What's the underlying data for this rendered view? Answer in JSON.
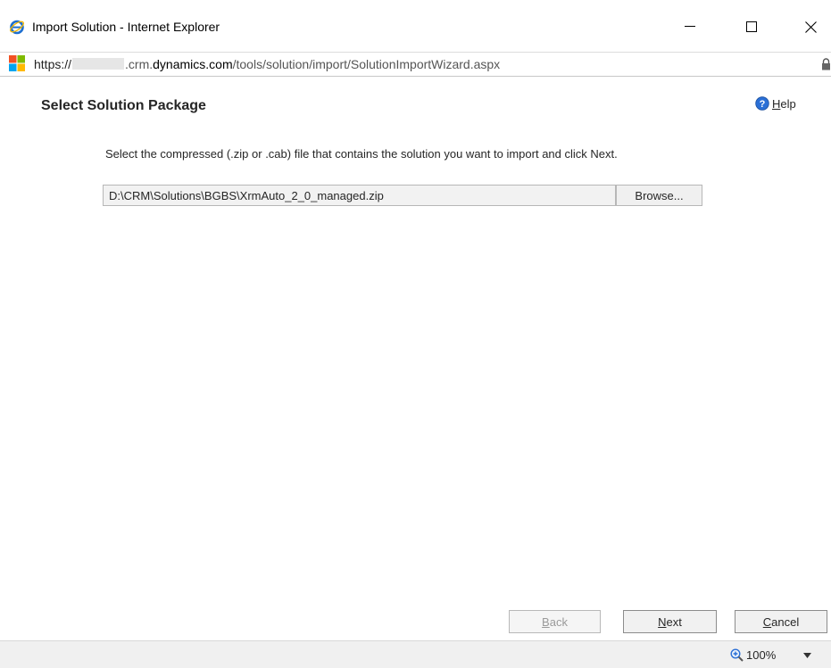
{
  "window": {
    "title": "Import Solution - Internet Explorer"
  },
  "address": {
    "scheme": "https://",
    "domain_suffix": ".crm.",
    "domain_bold": "dynamics.com",
    "path": "/tools/solution/import/SolutionImportWizard.aspx"
  },
  "page": {
    "title": "Select Solution Package",
    "help_label_prefix": "",
    "help_label_underlined": "H",
    "help_label_rest": "elp",
    "instruction": "Select the compressed (.zip or .cab) file that contains the solution you want to import and click Next.",
    "file_value": "D:\\CRM\\Solutions\\BGBS\\XrmAuto_2_0_managed.zip",
    "browse_label": "Browse..."
  },
  "wizard_buttons": {
    "back_accel": "B",
    "back_rest": "ack",
    "next_accel": "N",
    "next_rest": "ext",
    "cancel_accel": "C",
    "cancel_rest": "ancel"
  },
  "statusbar": {
    "zoom_level": "100%"
  },
  "colors": {
    "ie_blue": "#1e6fd0",
    "help_blue": "#2a6fd6"
  },
  "icons": {
    "ie": "internet-explorer-icon",
    "site": "microsoft-logo-icon",
    "lock": "lock-icon",
    "help": "help-icon",
    "zoom": "zoom-icon",
    "chevron": "chevron-down-icon"
  }
}
